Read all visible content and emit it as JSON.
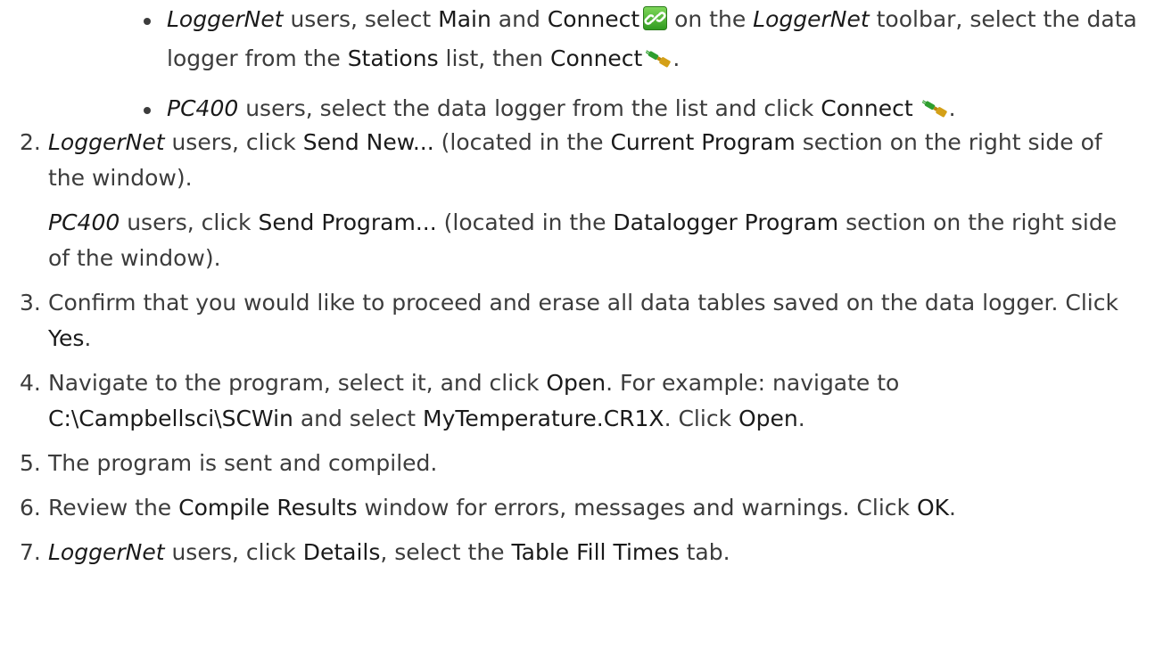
{
  "bullets": [
    {
      "t1": "LoggerNet",
      "t2": " users, select ",
      "t3": "Main",
      "t4": " and ",
      "t5": "Connect",
      "t6": " on the ",
      "t7": "LoggerNet",
      "t8": " toolbar, select the data logger from the ",
      "t9": "Stations",
      "t10": " list, then ",
      "t11": "Connect",
      "t12": "."
    },
    {
      "t1": "PC400",
      "t2": " users, select the data logger from the list and click ",
      "t3": "Connect",
      "t4": "."
    }
  ],
  "steps": [
    {
      "num": "2.",
      "p1": {
        "a": "LoggerNet",
        "b": " users, click ",
        "c": "Send New...",
        "d": " (located in the ",
        "e": "Current Program",
        "f": " section on the right side of the window)."
      },
      "p2": {
        "a": "PC400",
        "b": " users, click ",
        "c": "Send Program...",
        "d": " (located in the ",
        "e": "Datalogger Program",
        "f": " section on the right side of the window)."
      }
    },
    {
      "num": "3.",
      "a": "Confirm that you would like to proceed and erase all data tables saved on the data logger. Click ",
      "b": "Yes",
      "c": "."
    },
    {
      "num": "4.",
      "a": "Navigate to the program, select it, and click ",
      "b": "Open",
      "c": ". For example: navigate to ",
      "d": "C:\\Campbellsci\\SCWin",
      "e": " and select ",
      "f": "MyTemperature.CR1X",
      "g": ". Click ",
      "h": "Open",
      "i": "."
    },
    {
      "num": "5.",
      "a": "The program is sent and compiled."
    },
    {
      "num": "6.",
      "a": "Review the ",
      "b": "Compile Results",
      "c": " window for errors, messages and warnings. Click ",
      "d": "OK",
      "e": "."
    },
    {
      "num": "7.",
      "a": "LoggerNet",
      "b": " users, click ",
      "c": "Details",
      "d": ", select the ",
      "e": "Table Fill Times",
      "f": " tab."
    }
  ],
  "icons": {
    "toolbar_connect": "link-icon",
    "plug_connect": "plug-connect-icon"
  },
  "colors": {
    "text": "#3c3c3c",
    "emphasis": "#1a1a1a",
    "link_icon_bg": "#4cb82e",
    "plug_green": "#2e9e2e",
    "plug_gold": "#d4a017"
  }
}
